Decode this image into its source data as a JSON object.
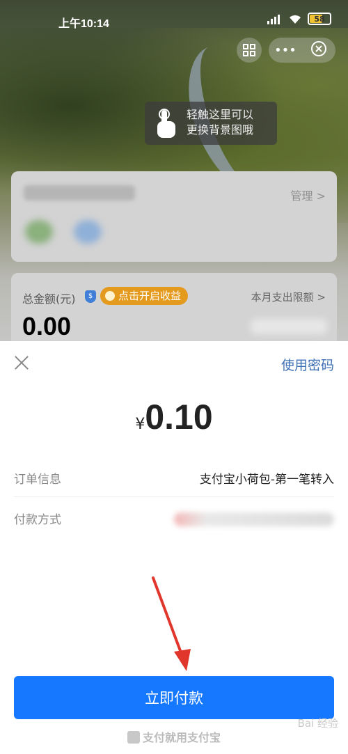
{
  "status_bar": {
    "time": "上午10:14",
    "battery": "58"
  },
  "background": {
    "hint_text_line1": "轻触这里可以",
    "hint_text_line2": "更换背景图哦",
    "card1": {
      "manage_label": "管理 >"
    },
    "card2": {
      "total_label": "总金额(元)",
      "earn_button": "点击开启收益",
      "limit_label": "本月支出限额 >",
      "amount": "0.00"
    }
  },
  "sheet": {
    "use_password": "使用密码",
    "price_symbol": "¥",
    "price_value": "0.10",
    "order_info_label": "订单信息",
    "order_info_value": "支付宝小荷包-第一笔转入",
    "payment_method_label": "付款方式",
    "pay_button": "立即付款",
    "footer": "支付就用支付宝",
    "watermark": "Bai 经验"
  },
  "colors": {
    "accent_blue": "#1677ff",
    "link_blue": "#3d6fb5",
    "earn_orange": "#e39a1d",
    "arrow_red": "#e0362c"
  }
}
